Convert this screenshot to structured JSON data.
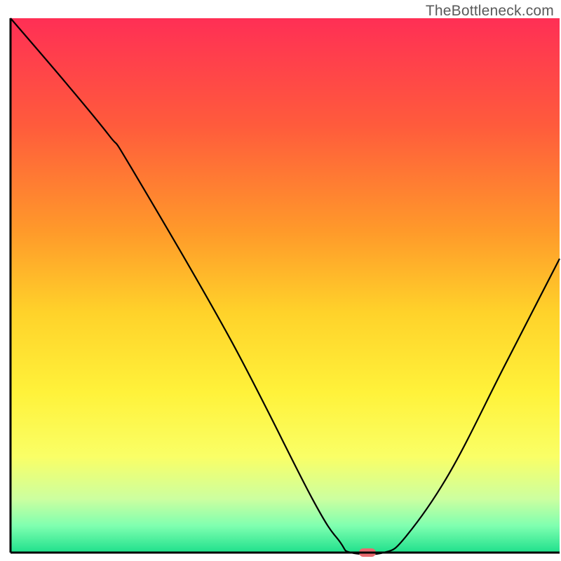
{
  "watermark": "TheBottleneck.com",
  "chart_data": {
    "type": "line",
    "title": "",
    "xlabel": "",
    "ylabel": "",
    "xlim": [
      0,
      100
    ],
    "ylim": [
      0,
      100
    ],
    "background_gradient": {
      "stops": [
        {
          "y": 0,
          "color": "#ff2f55"
        },
        {
          "y": 20,
          "color": "#ff5b3c"
        },
        {
          "y": 40,
          "color": "#ff9a2a"
        },
        {
          "y": 55,
          "color": "#ffd22a"
        },
        {
          "y": 70,
          "color": "#fff23a"
        },
        {
          "y": 82,
          "color": "#faff66"
        },
        {
          "y": 90,
          "color": "#ccffa0"
        },
        {
          "y": 95,
          "color": "#7fffb0"
        },
        {
          "y": 100,
          "color": "#1fe08c"
        }
      ]
    },
    "curve": {
      "description": "V-shaped bottleneck curve with minimum near x≈65",
      "points": [
        {
          "x": 0,
          "y": 100
        },
        {
          "x": 10,
          "y": 88
        },
        {
          "x": 18,
          "y": 78
        },
        {
          "x": 22,
          "y": 72
        },
        {
          "x": 40,
          "y": 40
        },
        {
          "x": 55,
          "y": 10
        },
        {
          "x": 60,
          "y": 2
        },
        {
          "x": 62,
          "y": 0
        },
        {
          "x": 68,
          "y": 0
        },
        {
          "x": 72,
          "y": 3
        },
        {
          "x": 80,
          "y": 15
        },
        {
          "x": 90,
          "y": 35
        },
        {
          "x": 100,
          "y": 55
        }
      ]
    },
    "marker": {
      "x": 65,
      "y": 0,
      "color": "#e86a6f",
      "shape": "pill"
    },
    "frame": {
      "left": true,
      "bottom": true,
      "top": false,
      "right": false,
      "stroke": "#000000",
      "width": 3
    }
  }
}
